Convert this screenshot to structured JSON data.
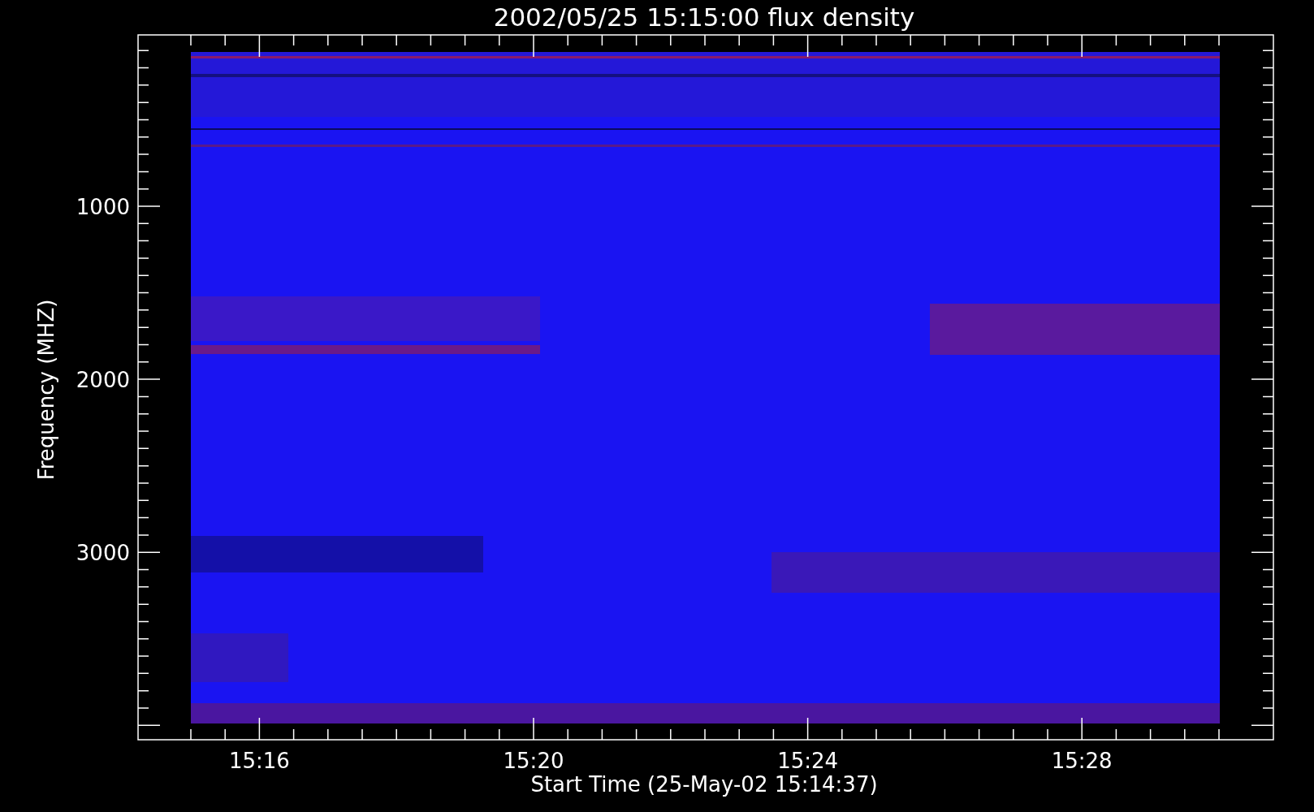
{
  "chart": {
    "title": "2002/05/25 15:15:00 flux density",
    "ylabel": "Frequency (MHZ)",
    "xlabel": "Start Time (25-May-02 15:14:37)",
    "yticks": [
      "1000",
      "2000",
      "3000"
    ],
    "xticks": [
      "15:16",
      "15:20",
      "15:24",
      "15:28"
    ]
  }
}
